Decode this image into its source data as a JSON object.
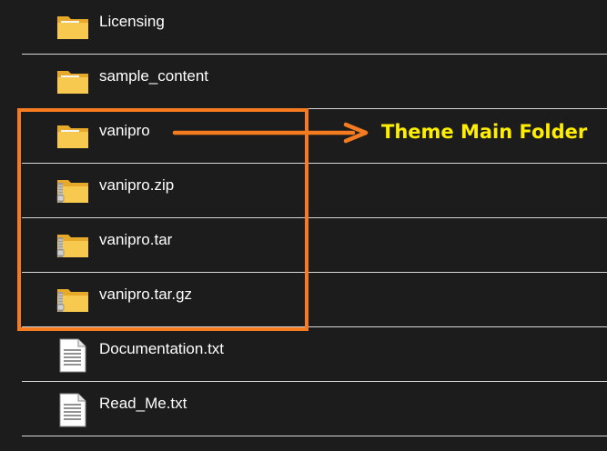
{
  "files": [
    {
      "name": "Licensing",
      "type": "folder"
    },
    {
      "name": "sample_content",
      "type": "folder"
    },
    {
      "name": "vanipro",
      "type": "folder"
    },
    {
      "name": "vanipro.zip",
      "type": "zip-folder"
    },
    {
      "name": "vanipro.tar",
      "type": "zip-folder"
    },
    {
      "name": "vanipro.tar.gz",
      "type": "zip-folder"
    },
    {
      "name": "Documentation.txt",
      "type": "text-file"
    },
    {
      "name": "Read_Me.txt",
      "type": "text-file"
    }
  ],
  "annotation": {
    "text": "Theme Main Folder",
    "text_color": "#ffee00",
    "highlight_color": "#f47b20"
  },
  "colors": {
    "background": "#1c1c1c",
    "separator": "#d8d8d8",
    "text": "#ffffff",
    "folder": "#f8c94f"
  }
}
